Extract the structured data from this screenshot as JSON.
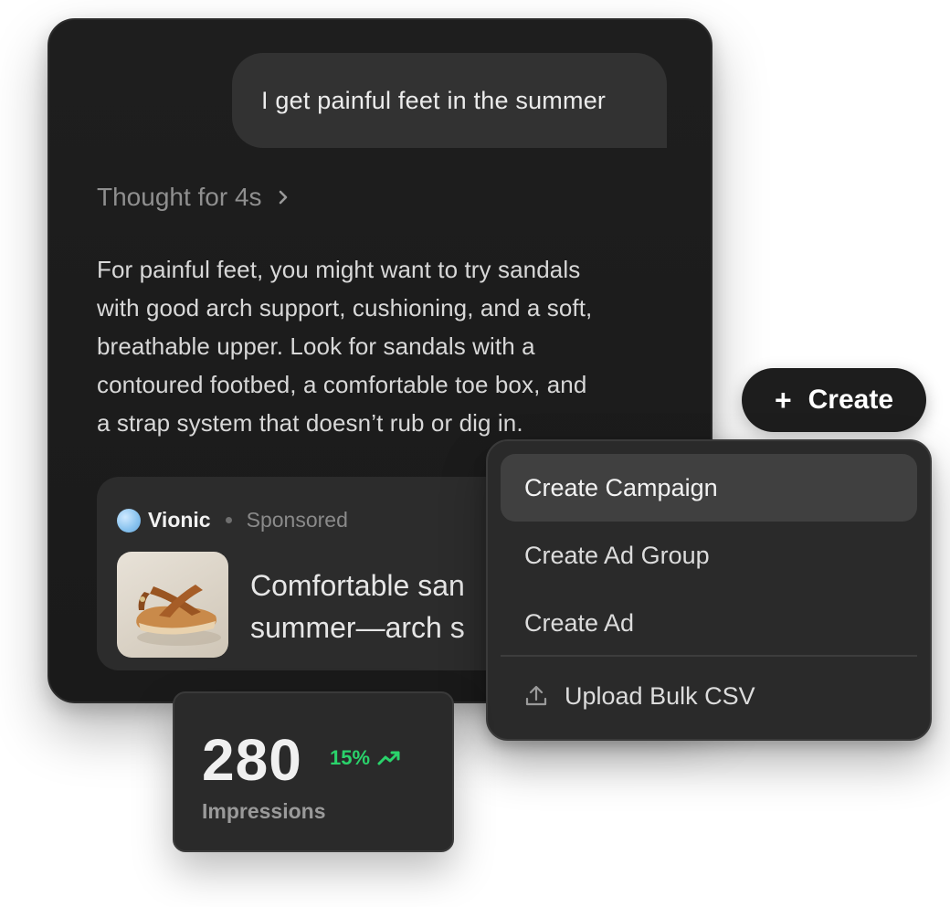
{
  "chat": {
    "user_message": "I get painful feet in the summer",
    "thought_label": "Thought for 4s",
    "answer_lines": [
      "For painful feet, you might want to try sandals",
      "with good arch support, cushioning, and a soft,",
      "breathable upper. Look for sandals with a",
      "contoured footbed, a comfortable toe box, and",
      "a strap system that doesn’t rub or dig in."
    ]
  },
  "ad": {
    "brand": "Vionic",
    "sponsored_label": "Sponsored",
    "title_lines": [
      "Comfortable san",
      "summer—arch s"
    ],
    "thumbnail_icon": "sandal-image"
  },
  "create_button": {
    "icon": "plus-icon",
    "label": "Create"
  },
  "menu": {
    "items": [
      {
        "label": "Create Campaign",
        "active": true
      },
      {
        "label": "Create Ad Group",
        "active": false
      },
      {
        "label": "Create Ad",
        "active": false
      }
    ],
    "upload": {
      "icon": "upload-icon",
      "label": "Upload Bulk CSV"
    }
  },
  "stats": {
    "value": "280",
    "change": "15%",
    "change_icon": "trending-up-icon",
    "label": "Impressions",
    "accent_color": "#2ad36b"
  }
}
